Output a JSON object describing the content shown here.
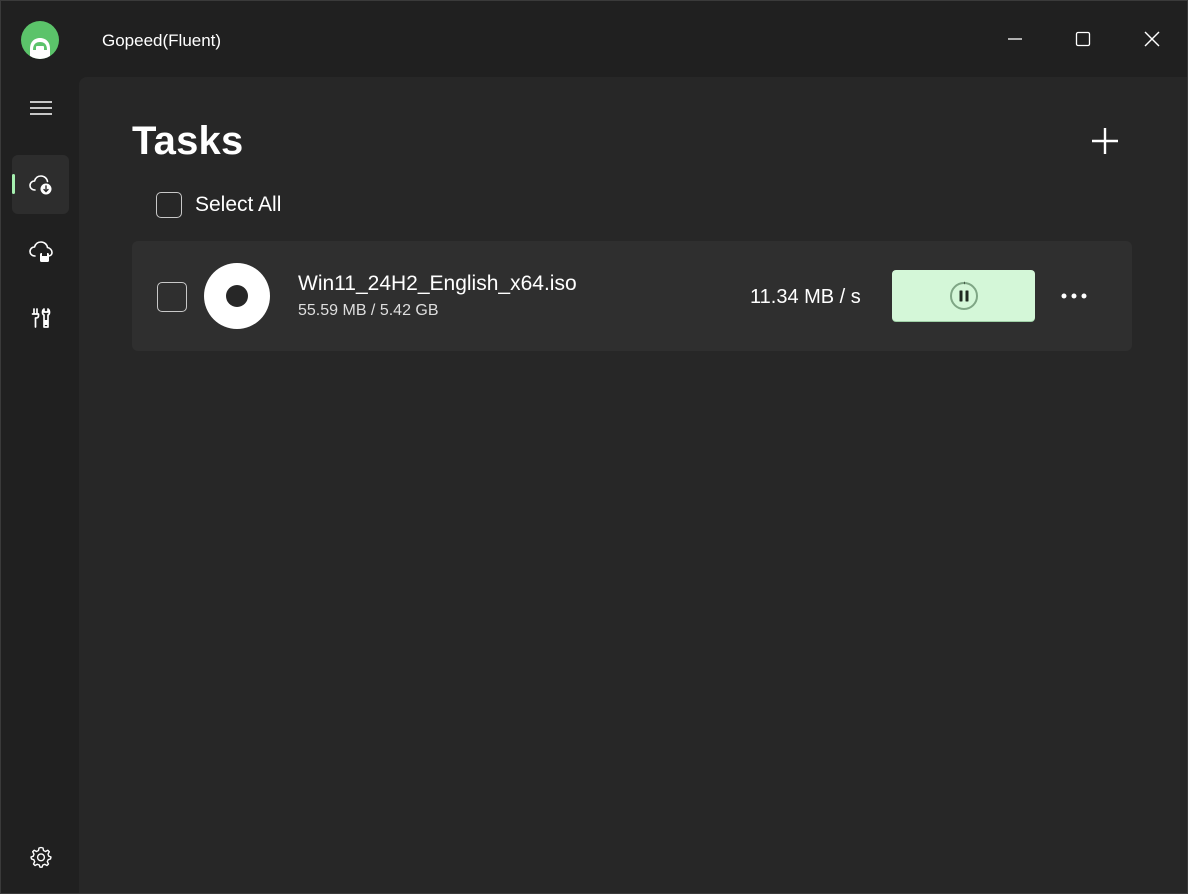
{
  "window": {
    "title": "Gopeed(Fluent)",
    "logo_icon": "gopeed-logo-icon",
    "controls": [
      "minimize-icon",
      "maximize-icon",
      "close-icon"
    ]
  },
  "nav": {
    "items": [
      {
        "name": "menu",
        "icon": "hamburger-icon"
      },
      {
        "name": "tasks",
        "icon": "cloud-download-icon",
        "active": true
      },
      {
        "name": "downloads",
        "icon": "cloud-save-icon"
      },
      {
        "name": "tools",
        "icon": "tools-icon"
      },
      {
        "name": "settings",
        "icon": "gear-icon"
      }
    ]
  },
  "main": {
    "title": "Tasks",
    "add_icon": "plus-icon",
    "select_all_label": "Select All",
    "tasks": [
      {
        "file_name": "Win11_24H2_English_x64.iso",
        "size": "55.59 MB / 5.42 GB",
        "speed": "11.34 MB / s",
        "file_icon": "disc-icon",
        "action_icon": "pause-icon",
        "more_icon": "more-horizontal-icon"
      }
    ]
  },
  "colors": {
    "background": "#202020",
    "content": "#272727",
    "card": "#2f2f2f",
    "accent": "#5bc36a",
    "pause_button": "#d4f7d8",
    "active_indicator": "#a6f0b0"
  }
}
